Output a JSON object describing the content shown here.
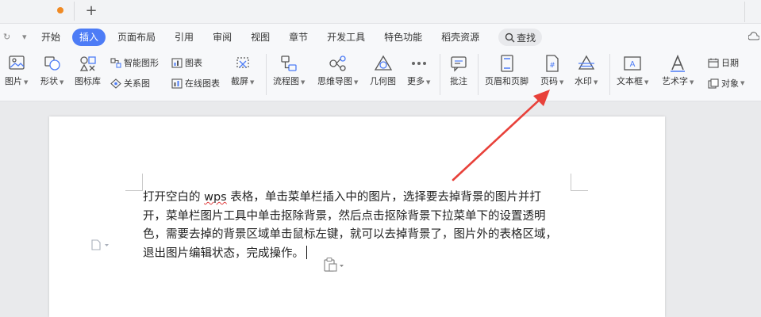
{
  "menu": {
    "items": [
      "开始",
      "插入",
      "页面布局",
      "引用",
      "审阅",
      "视图",
      "章节",
      "开发工具",
      "特色功能",
      "稻壳资源"
    ],
    "active": "插入",
    "search_label": "查找"
  },
  "toolbar": {
    "picture": "图片",
    "shape": "形状",
    "icon_lib": "图标库",
    "smart_graphic": "智能图形",
    "chart": "图表",
    "relation": "关系图",
    "online_chart": "在线图表",
    "screenshot": "截屏",
    "flowchart": "流程图",
    "mindmap": "思维导图",
    "geometry": "几何图",
    "more": "更多",
    "comment": "批注",
    "header_footer": "页眉和页脚",
    "page_number": "页码",
    "watermark": "水印",
    "textbox": "文本框",
    "wordart": "艺术字",
    "date": "日期",
    "object": "对象"
  },
  "document": {
    "lines": [
      [
        "打开空白的 ",
        "wps",
        " 表格，单击菜单栏插入中的图片，选择要去掉背景的图片并打"
      ],
      "开，菜单栏图片工具中单击抠除背景，然后点击抠除背景下拉菜单下的设置透明",
      "色，需要去掉的背景区域单击鼠标左键，就可以去掉背景了，图片外的表格区域，",
      "退出图片编辑状态，完成操作。"
    ]
  },
  "colors": {
    "accent": "#4d7cf6",
    "arrow": "#e8413a",
    "tab_dot": "#f08a24"
  }
}
